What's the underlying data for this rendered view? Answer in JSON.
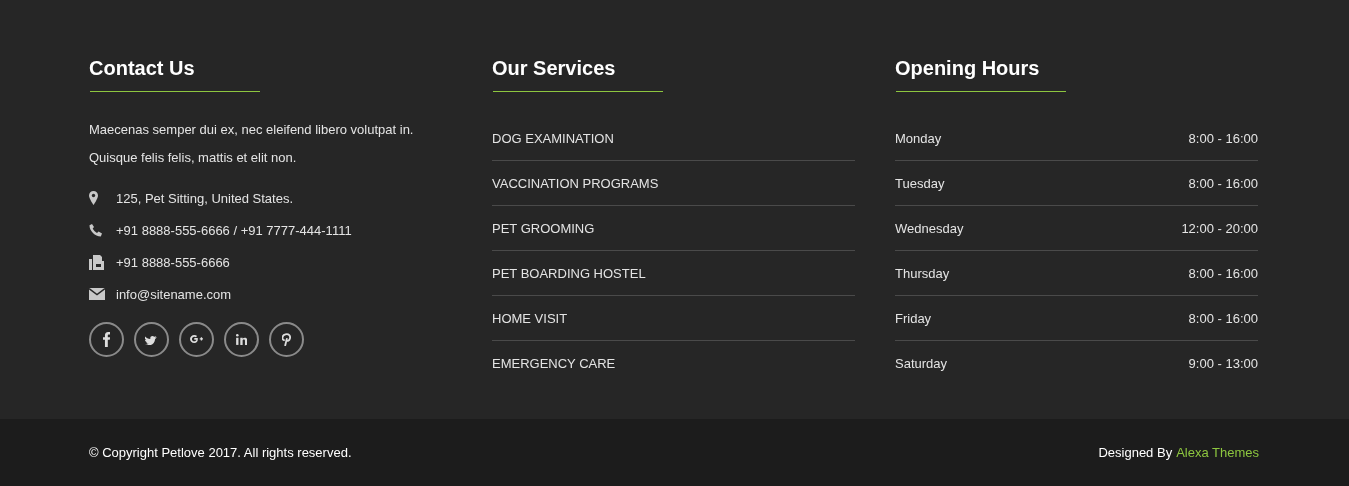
{
  "columns": {
    "contact": {
      "title": "Contact Us",
      "text": "Maecenas semper dui ex, nec eleifend libero volutpat in. Quisque felis felis, mattis et elit non.",
      "items": [
        {
          "kind": "address",
          "text": "125, Pet Sitting, United States."
        },
        {
          "kind": "phone",
          "text": "+91 8888-555-6666 / +91 7777-444-1111"
        },
        {
          "kind": "fax",
          "text": "+91 8888-555-6666"
        },
        {
          "kind": "email",
          "text": "info@sitename.com"
        }
      ],
      "social": [
        {
          "kind": "facebook"
        },
        {
          "kind": "twitter"
        },
        {
          "kind": "google-plus"
        },
        {
          "kind": "linkedin"
        },
        {
          "kind": "pinterest"
        }
      ]
    },
    "services": {
      "title": "Our Services",
      "items": [
        "DOG EXAMINATION",
        "VACCINATION PROGRAMS",
        "PET GROOMING",
        "PET BOARDING HOSTEL",
        "HOME VISIT",
        "EMERGENCY CARE"
      ]
    },
    "hours": {
      "title": "Opening Hours",
      "rows": [
        {
          "day": "Monday",
          "time": "8:00 - 16:00"
        },
        {
          "day": "Tuesday",
          "time": "8:00 - 16:00"
        },
        {
          "day": "Wednesday",
          "time": "12:00 - 20:00"
        },
        {
          "day": "Thursday",
          "time": "8:00 - 16:00"
        },
        {
          "day": "Friday",
          "time": "8:00 - 16:00"
        },
        {
          "day": "Saturday",
          "time": "9:00 - 13:00"
        }
      ]
    }
  },
  "bottom_bar": {
    "copyright": "© Copyright Petlove 2017. All rights reserved.",
    "credit_prefix": "Designed By",
    "credit_link": "Alexa Themes"
  }
}
